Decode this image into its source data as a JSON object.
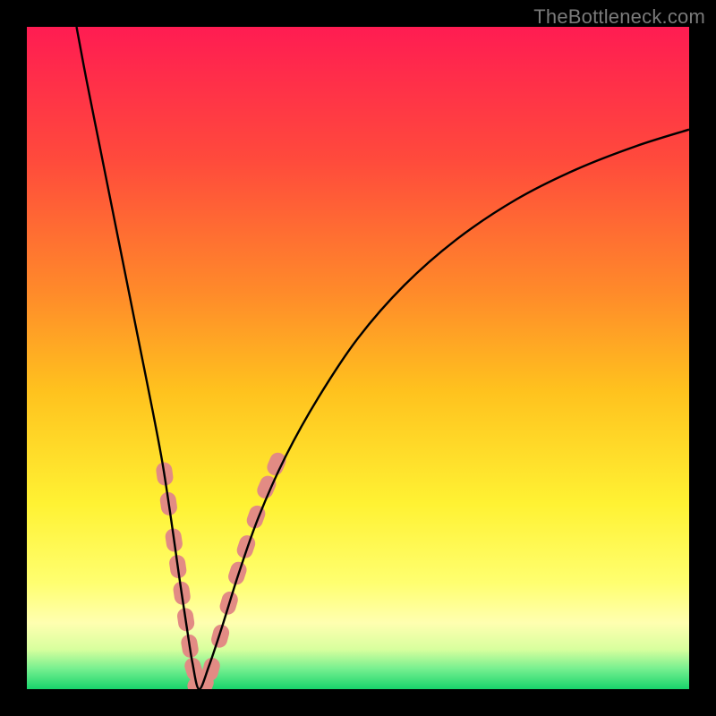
{
  "watermark": "TheBottleneck.com",
  "colors": {
    "frame": "#000000",
    "gradient_stops": [
      {
        "offset": 0.0,
        "color": "#ff1c52"
      },
      {
        "offset": 0.2,
        "color": "#ff4a3c"
      },
      {
        "offset": 0.4,
        "color": "#ff8a2a"
      },
      {
        "offset": 0.55,
        "color": "#ffc21e"
      },
      {
        "offset": 0.72,
        "color": "#fff233"
      },
      {
        "offset": 0.84,
        "color": "#ffff70"
      },
      {
        "offset": 0.9,
        "color": "#ffffb0"
      },
      {
        "offset": 0.94,
        "color": "#d8ff9e"
      },
      {
        "offset": 0.97,
        "color": "#74ef8f"
      },
      {
        "offset": 1.0,
        "color": "#18d46b"
      }
    ],
    "curve": "#000000",
    "markers": "#e28b84"
  },
  "chart_data": {
    "type": "line",
    "title": "",
    "xlabel": "",
    "ylabel": "",
    "xlim": [
      0,
      1
    ],
    "ylim": [
      0,
      1
    ],
    "x_vertex": 0.26,
    "series": [
      {
        "name": "bottleneck-curve",
        "points": [
          {
            "x": 0.075,
            "y": 1.0
          },
          {
            "x": 0.09,
            "y": 0.92
          },
          {
            "x": 0.11,
            "y": 0.82
          },
          {
            "x": 0.13,
            "y": 0.72
          },
          {
            "x": 0.15,
            "y": 0.62
          },
          {
            "x": 0.17,
            "y": 0.52
          },
          {
            "x": 0.19,
            "y": 0.42
          },
          {
            "x": 0.205,
            "y": 0.34
          },
          {
            "x": 0.218,
            "y": 0.255
          },
          {
            "x": 0.23,
            "y": 0.17
          },
          {
            "x": 0.242,
            "y": 0.09
          },
          {
            "x": 0.25,
            "y": 0.04
          },
          {
            "x": 0.26,
            "y": 0.0
          },
          {
            "x": 0.275,
            "y": 0.035
          },
          {
            "x": 0.295,
            "y": 0.095
          },
          {
            "x": 0.32,
            "y": 0.175
          },
          {
            "x": 0.35,
            "y": 0.26
          },
          {
            "x": 0.39,
            "y": 0.35
          },
          {
            "x": 0.44,
            "y": 0.44
          },
          {
            "x": 0.5,
            "y": 0.53
          },
          {
            "x": 0.57,
            "y": 0.61
          },
          {
            "x": 0.65,
            "y": 0.68
          },
          {
            "x": 0.74,
            "y": 0.74
          },
          {
            "x": 0.83,
            "y": 0.785
          },
          {
            "x": 0.92,
            "y": 0.82
          },
          {
            "x": 1.0,
            "y": 0.845
          }
        ]
      }
    ],
    "markers": {
      "name": "highlighted-region",
      "shape": "rounded-segment",
      "points": [
        {
          "x": 0.208,
          "y": 0.325
        },
        {
          "x": 0.214,
          "y": 0.28
        },
        {
          "x": 0.222,
          "y": 0.225
        },
        {
          "x": 0.228,
          "y": 0.185
        },
        {
          "x": 0.234,
          "y": 0.145
        },
        {
          "x": 0.24,
          "y": 0.105
        },
        {
          "x": 0.246,
          "y": 0.065
        },
        {
          "x": 0.252,
          "y": 0.03
        },
        {
          "x": 0.26,
          "y": 0.005
        },
        {
          "x": 0.268,
          "y": 0.005
        },
        {
          "x": 0.278,
          "y": 0.03
        },
        {
          "x": 0.292,
          "y": 0.08
        },
        {
          "x": 0.305,
          "y": 0.13
        },
        {
          "x": 0.318,
          "y": 0.175
        },
        {
          "x": 0.331,
          "y": 0.215
        },
        {
          "x": 0.346,
          "y": 0.26
        },
        {
          "x": 0.362,
          "y": 0.305
        },
        {
          "x": 0.377,
          "y": 0.34
        }
      ]
    }
  }
}
